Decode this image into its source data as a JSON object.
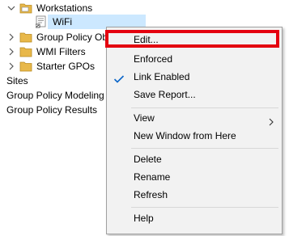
{
  "tree": {
    "workstations": "Workstations",
    "wifi": "WiFi",
    "group_policy_objects": "Group Policy Ob",
    "wmi_filters": "WMI Filters",
    "starter_gpos": "Starter GPOs",
    "sites": "Sites",
    "group_policy_modeling": "Group Policy Modeling",
    "group_policy_results": "Group Policy Results"
  },
  "context_menu": {
    "edit": "Edit...",
    "enforced": "Enforced",
    "link_enabled": "Link Enabled",
    "save_report": "Save Report...",
    "view": "View",
    "new_window": "New Window from Here",
    "delete": "Delete",
    "rename": "Rename",
    "refresh": "Refresh",
    "help": "Help"
  },
  "colors": {
    "selection": "#cce8ff",
    "highlight_box": "#e4000f",
    "check": "#0a64c8",
    "folder": "#e8b84a"
  },
  "icons": {
    "expand": "chevron-right-icon",
    "collapse": "chevron-down-icon",
    "folder": "folder-icon",
    "gpo_link": "gpo-link-icon",
    "check": "check-icon",
    "submenu": "submenu-arrow-icon"
  }
}
